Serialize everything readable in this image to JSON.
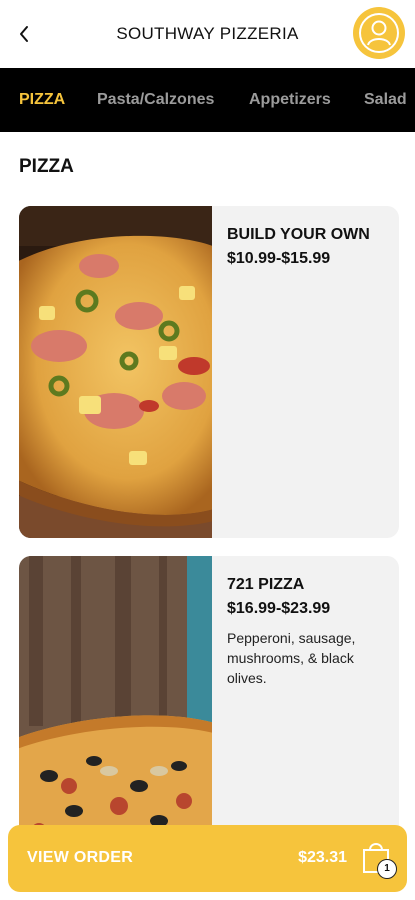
{
  "header": {
    "title": "SOUTHWAY PIZZERIA",
    "back_icon": "chevron-left-icon",
    "profile_icon": "user-icon"
  },
  "tabs": [
    {
      "label": "PIZZA",
      "active": true
    },
    {
      "label": "Pasta/Calzones",
      "active": false
    },
    {
      "label": "Appetizers",
      "active": false
    },
    {
      "label": "Salad",
      "active": false
    }
  ],
  "section": {
    "title": "PIZZA"
  },
  "items": [
    {
      "name": "BUILD YOUR OWN",
      "price": "$10.99-$15.99",
      "description": ""
    },
    {
      "name": "721 PIZZA",
      "price": "$16.99-$23.99",
      "description": "Pepperoni, sausage, mushrooms, & black olives."
    }
  ],
  "order": {
    "label": "VIEW ORDER",
    "total": "$23.31",
    "bag_count": "1",
    "bag_icon": "shopping-bag-icon"
  },
  "colors": {
    "accent": "#f6c43c",
    "tab_bar": "#000000",
    "card_bg": "#f2f2f2"
  }
}
